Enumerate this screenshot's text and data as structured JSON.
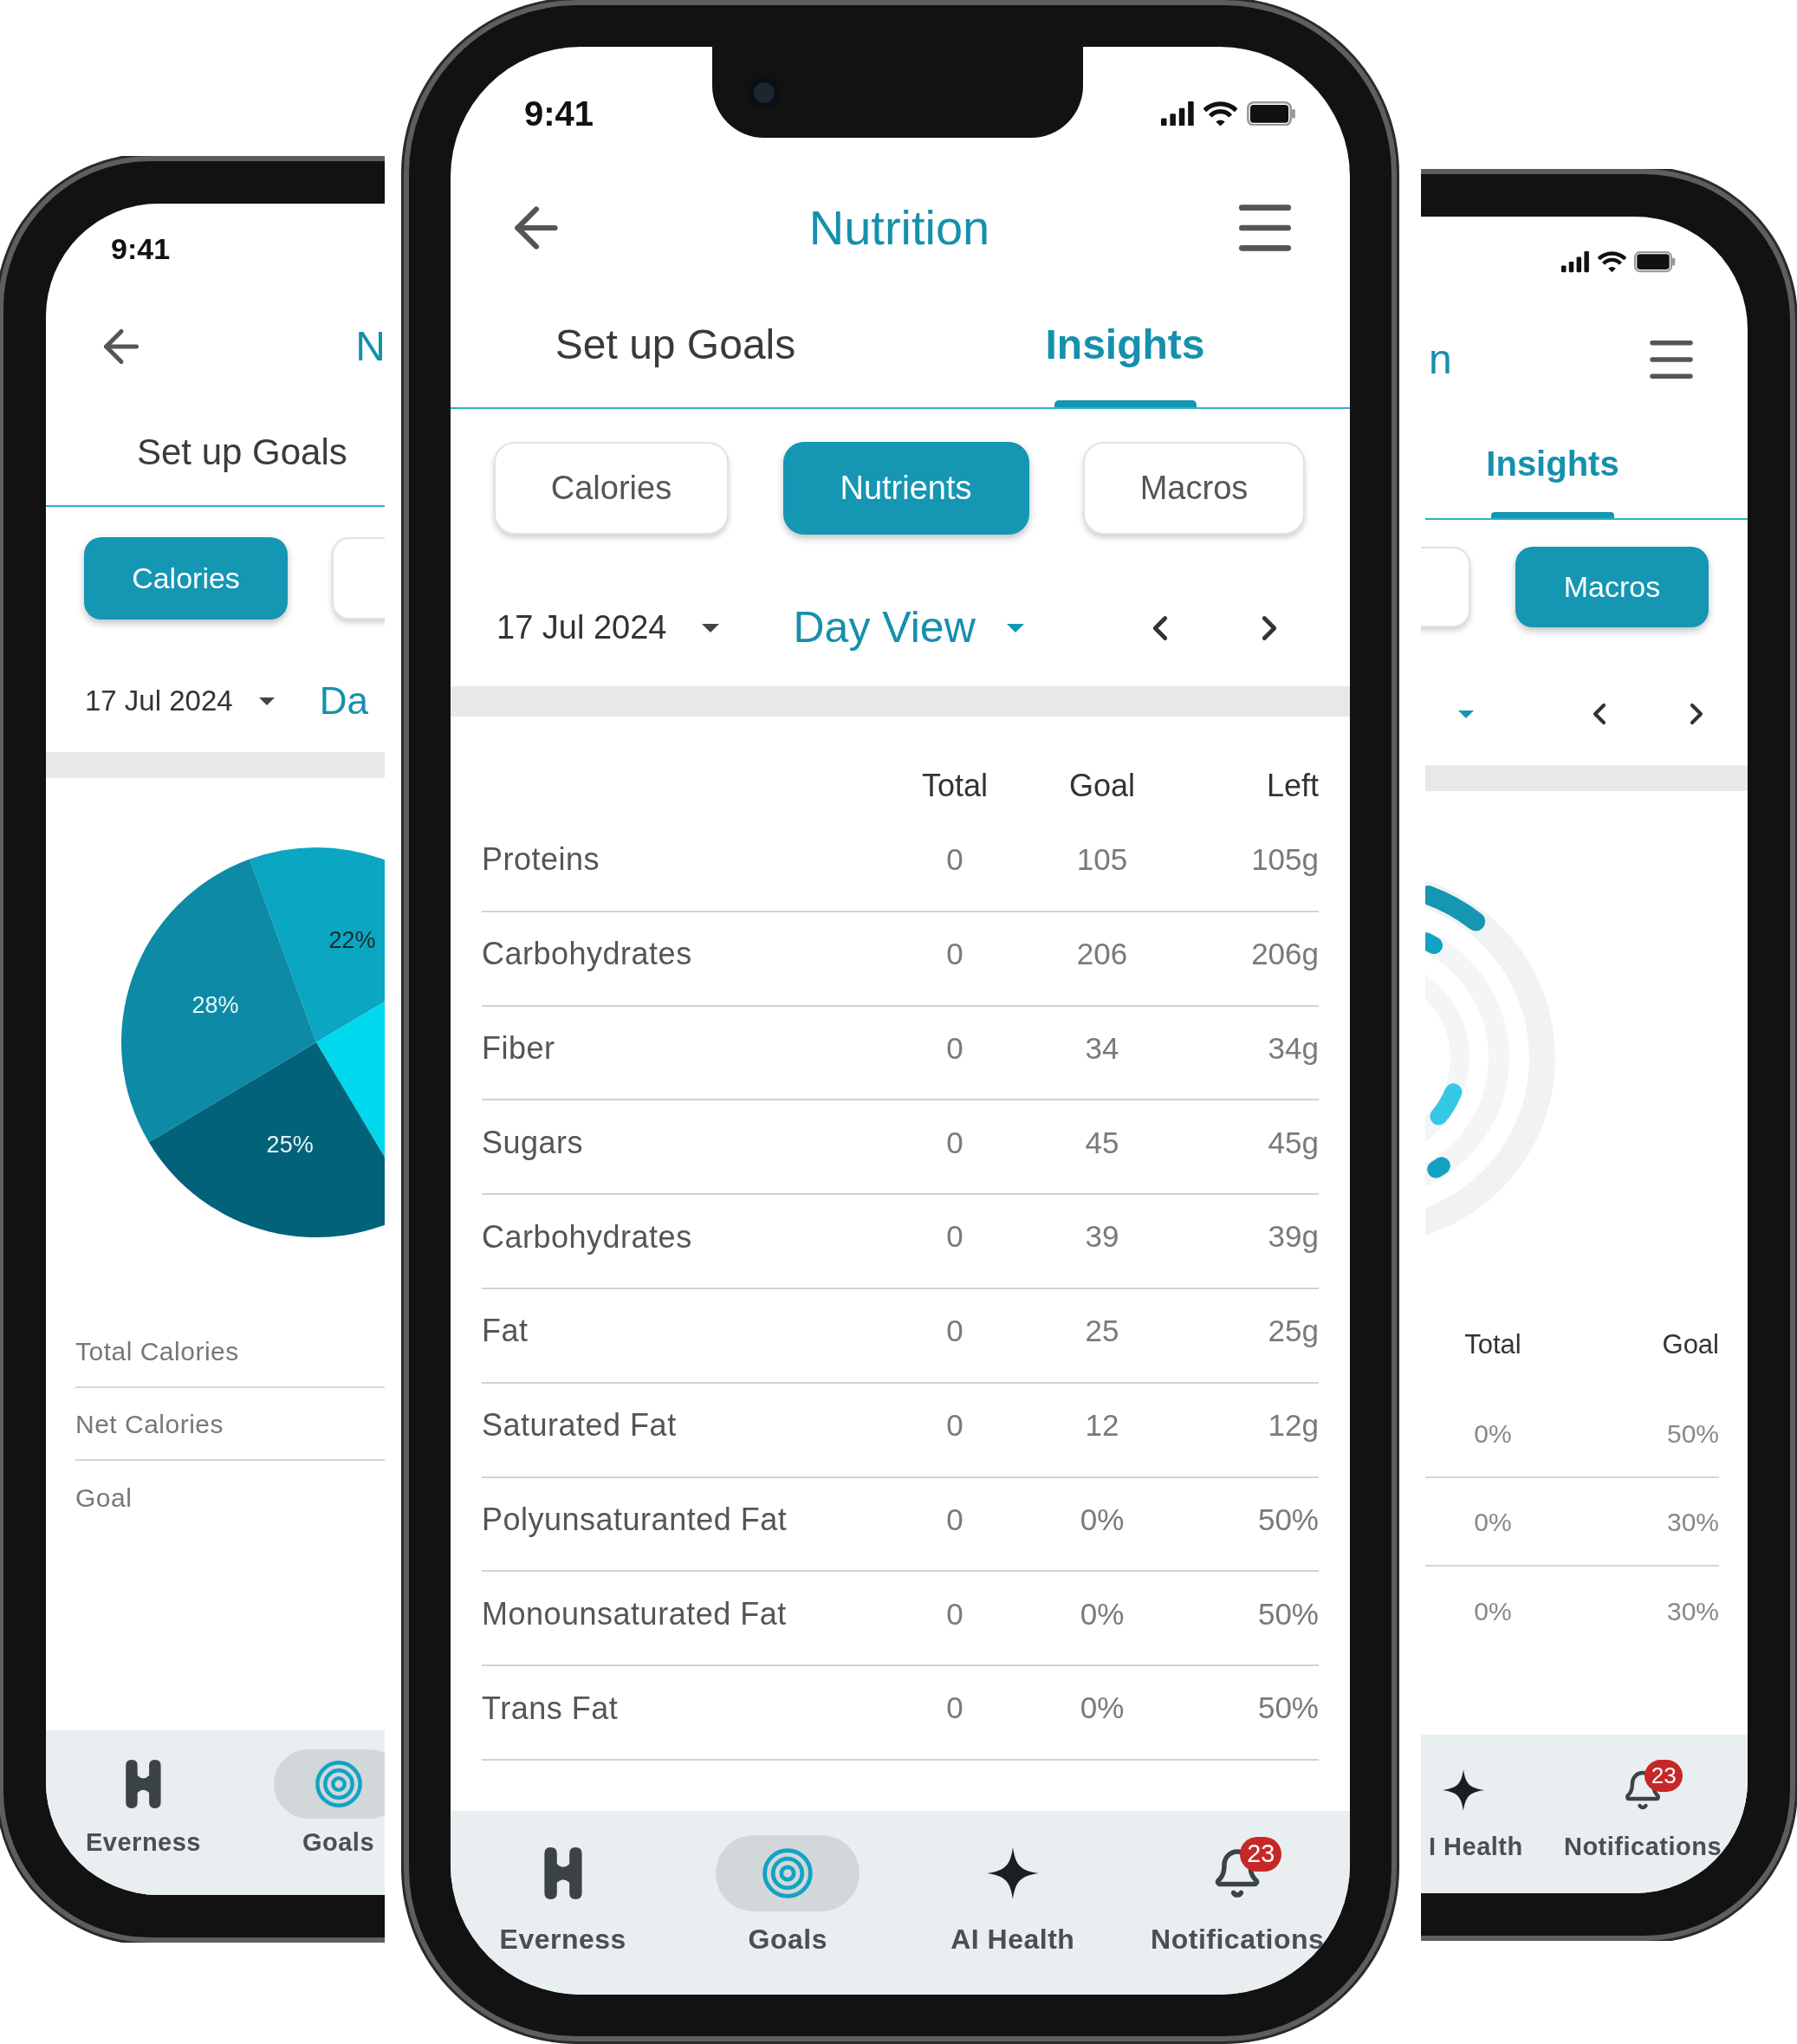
{
  "left_phone": {
    "time": "9:41",
    "title": "N",
    "tabs": [
      {
        "label": "Set up Goals",
        "selected": false
      }
    ],
    "filters": [
      {
        "label": "Calories",
        "selected": true
      },
      {
        "selected": false
      }
    ],
    "date": "17 Jul 2024",
    "view": "Da",
    "chart_data": {
      "type": "pie",
      "values": [
        22,
        25,
        25,
        28
      ],
      "value_labels": [
        "22%",
        null,
        "25%",
        "28%"
      ]
    },
    "summary": [
      "Total Calories",
      "Net Calories",
      "Goal"
    ],
    "nav": [
      {
        "kind": "logo",
        "label": "Everness",
        "selected": false
      },
      {
        "kind": "target",
        "label": "Goals",
        "selected": true
      }
    ]
  },
  "main_phone": {
    "time": "9:41",
    "title": "Nutrition",
    "tabs": [
      {
        "label": "Set up Goals",
        "selected": false
      },
      {
        "label": "Insights",
        "selected": true
      }
    ],
    "filters": [
      {
        "label": "Calories",
        "selected": false
      },
      {
        "label": "Nutrients",
        "selected": true
      },
      {
        "label": "Macros",
        "selected": false
      }
    ],
    "date": "17 Jul 2024",
    "view": "Day View",
    "table": {
      "columns": [
        "Total",
        "Goal",
        "Left"
      ],
      "rows": [
        {
          "name": "Proteins",
          "cells": [
            "0",
            "105",
            "105g"
          ]
        },
        {
          "name": "Carbohydrates",
          "cells": [
            "0",
            "206",
            "206g"
          ]
        },
        {
          "name": "Fiber",
          "cells": [
            "0",
            "34",
            "34g"
          ]
        },
        {
          "name": "Sugars",
          "cells": [
            "0",
            "45",
            "45g"
          ]
        },
        {
          "name": "Carbohydrates",
          "cells": [
            "0",
            "39",
            "39g"
          ]
        },
        {
          "name": "Fat",
          "cells": [
            "0",
            "25",
            "25g"
          ]
        },
        {
          "name": "Saturated Fat",
          "cells": [
            "0",
            "12",
            "12g"
          ]
        },
        {
          "name": "Polyunsaturanted Fat",
          "cells": [
            "0",
            "0%",
            "50%"
          ]
        },
        {
          "name": "Monounsaturated Fat",
          "cells": [
            "0",
            "0%",
            "50%"
          ]
        },
        {
          "name": "Trans Fat",
          "cells": [
            "0",
            "0%",
            "50%"
          ]
        }
      ]
    },
    "nav": [
      {
        "kind": "logo",
        "label": "Everness",
        "selected": false
      },
      {
        "kind": "target",
        "label": "Goals",
        "selected": true
      },
      {
        "kind": "sparkle",
        "label": "AI Health",
        "selected": false
      },
      {
        "kind": "bell",
        "label": "Notifications",
        "selected": false,
        "badge": "23"
      }
    ]
  },
  "right_phone": {
    "title": "n",
    "tabs": [
      {
        "label": "Insights",
        "selected": true
      }
    ],
    "filters": [
      {
        "selected": false
      },
      {
        "label": "Macros",
        "selected": true
      }
    ],
    "table": {
      "columns": [
        "Total",
        "Goal"
      ],
      "rows": [
        [
          "0%",
          "50%"
        ],
        [
          "0%",
          "30%"
        ],
        [
          "0%",
          "30%"
        ]
      ]
    },
    "nav": [
      {
        "kind": "sparkle",
        "label": "I Health",
        "selected": false
      },
      {
        "kind": "bell",
        "label": "Notifications",
        "selected": false,
        "badge": "23"
      }
    ]
  }
}
